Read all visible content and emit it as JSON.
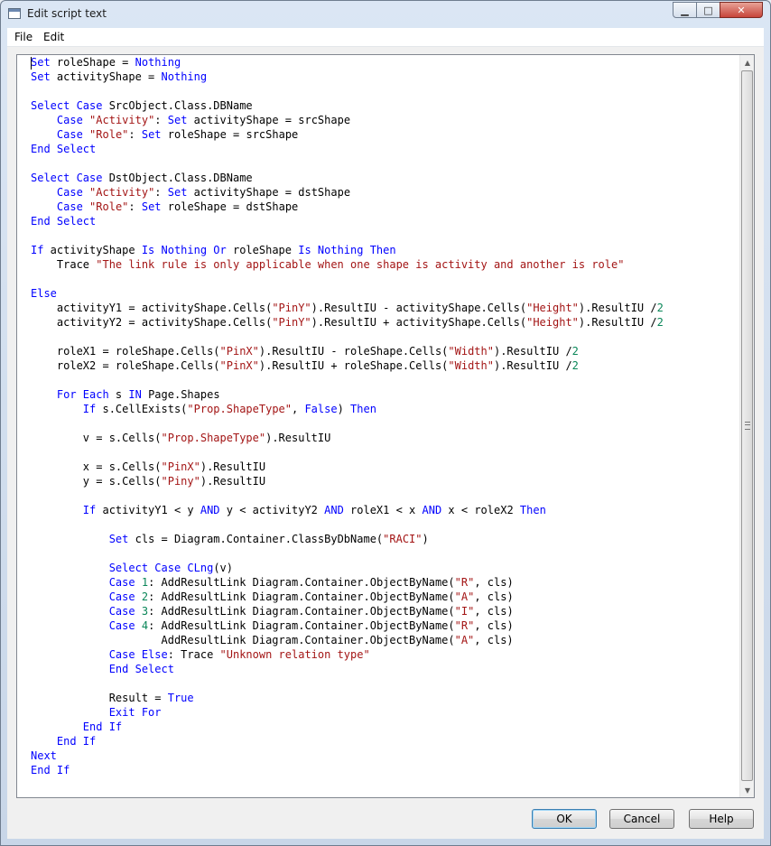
{
  "window": {
    "title": "Edit script text"
  },
  "title_controls": {
    "minimize_icon": "minimize-icon",
    "maximize_icon": "maximize-icon",
    "close_icon": "close-icon"
  },
  "menu": {
    "items": [
      "File",
      "Edit"
    ]
  },
  "editor": {
    "lines": [
      [
        [
          "kw",
          "Set"
        ],
        [
          "t",
          " roleShape = "
        ],
        [
          "kw",
          "Nothing"
        ]
      ],
      [
        [
          "kw",
          "Set"
        ],
        [
          "t",
          " activityShape = "
        ],
        [
          "kw",
          "Nothing"
        ]
      ],
      [],
      [
        [
          "kw",
          "Select Case"
        ],
        [
          "t",
          " SrcObject.Class.DBName"
        ]
      ],
      [
        [
          "t",
          "    "
        ],
        [
          "kw",
          "Case"
        ],
        [
          "t",
          " "
        ],
        [
          "str",
          "\"Activity\""
        ],
        [
          "t",
          ": "
        ],
        [
          "kw",
          "Set"
        ],
        [
          "t",
          " activityShape = srcShape"
        ]
      ],
      [
        [
          "t",
          "    "
        ],
        [
          "kw",
          "Case"
        ],
        [
          "t",
          " "
        ],
        [
          "str",
          "\"Role\""
        ],
        [
          "t",
          ": "
        ],
        [
          "kw",
          "Set"
        ],
        [
          "t",
          " roleShape = srcShape"
        ]
      ],
      [
        [
          "kw",
          "End Select"
        ]
      ],
      [],
      [
        [
          "kw",
          "Select Case"
        ],
        [
          "t",
          " DstObject.Class.DBName"
        ]
      ],
      [
        [
          "t",
          "    "
        ],
        [
          "kw",
          "Case"
        ],
        [
          "t",
          " "
        ],
        [
          "str",
          "\"Activity\""
        ],
        [
          "t",
          ": "
        ],
        [
          "kw",
          "Set"
        ],
        [
          "t",
          " activityShape = dstShape"
        ]
      ],
      [
        [
          "t",
          "    "
        ],
        [
          "kw",
          "Case"
        ],
        [
          "t",
          " "
        ],
        [
          "str",
          "\"Role\""
        ],
        [
          "t",
          ": "
        ],
        [
          "kw",
          "Set"
        ],
        [
          "t",
          " roleShape = dstShape"
        ]
      ],
      [
        [
          "kw",
          "End Select"
        ]
      ],
      [],
      [
        [
          "kw",
          "If"
        ],
        [
          "t",
          " activityShape "
        ],
        [
          "kw",
          "Is Nothing Or"
        ],
        [
          "t",
          " roleShape "
        ],
        [
          "kw",
          "Is Nothing Then"
        ]
      ],
      [
        [
          "t",
          "    Trace "
        ],
        [
          "str",
          "\"The link rule is only applicable when one shape is activity and another is role\""
        ]
      ],
      [],
      [
        [
          "kw",
          "Else"
        ]
      ],
      [
        [
          "t",
          "    activityY1 = activityShape.Cells("
        ],
        [
          "str",
          "\"PinY\""
        ],
        [
          "t",
          ").ResultIU - activityShape.Cells("
        ],
        [
          "str",
          "\"Height\""
        ],
        [
          "t",
          ").ResultIU /"
        ],
        [
          "num",
          "2"
        ]
      ],
      [
        [
          "t",
          "    activityY2 = activityShape.Cells("
        ],
        [
          "str",
          "\"PinY\""
        ],
        [
          "t",
          ").ResultIU + activityShape.Cells("
        ],
        [
          "str",
          "\"Height\""
        ],
        [
          "t",
          ").ResultIU /"
        ],
        [
          "num",
          "2"
        ]
      ],
      [],
      [
        [
          "t",
          "    roleX1 = roleShape.Cells("
        ],
        [
          "str",
          "\"PinX\""
        ],
        [
          "t",
          ").ResultIU - roleShape.Cells("
        ],
        [
          "str",
          "\"Width\""
        ],
        [
          "t",
          ").ResultIU /"
        ],
        [
          "num",
          "2"
        ]
      ],
      [
        [
          "t",
          "    roleX2 = roleShape.Cells("
        ],
        [
          "str",
          "\"PinX\""
        ],
        [
          "t",
          ").ResultIU + roleShape.Cells("
        ],
        [
          "str",
          "\"Width\""
        ],
        [
          "t",
          ").ResultIU /"
        ],
        [
          "num",
          "2"
        ]
      ],
      [],
      [
        [
          "t",
          "    "
        ],
        [
          "kw",
          "For Each"
        ],
        [
          "t",
          " s "
        ],
        [
          "kw",
          "IN"
        ],
        [
          "t",
          " Page.Shapes"
        ]
      ],
      [
        [
          "t",
          "        "
        ],
        [
          "kw",
          "If"
        ],
        [
          "t",
          " s.CellExists("
        ],
        [
          "str",
          "\"Prop.ShapeType\""
        ],
        [
          "t",
          ", "
        ],
        [
          "kw",
          "False"
        ],
        [
          "t",
          ") "
        ],
        [
          "kw",
          "Then"
        ]
      ],
      [],
      [
        [
          "t",
          "        v = s.Cells("
        ],
        [
          "str",
          "\"Prop.ShapeType\""
        ],
        [
          "t",
          ").ResultIU"
        ]
      ],
      [],
      [
        [
          "t",
          "        x = s.Cells("
        ],
        [
          "str",
          "\"PinX\""
        ],
        [
          "t",
          ").ResultIU"
        ]
      ],
      [
        [
          "t",
          "        y = s.Cells("
        ],
        [
          "str",
          "\"Piny\""
        ],
        [
          "t",
          ").ResultIU"
        ]
      ],
      [],
      [
        [
          "t",
          "        "
        ],
        [
          "kw",
          "If"
        ],
        [
          "t",
          " activityY1 < y "
        ],
        [
          "kw",
          "AND"
        ],
        [
          "t",
          " y < activityY2 "
        ],
        [
          "kw",
          "AND"
        ],
        [
          "t",
          " roleX1 < x "
        ],
        [
          "kw",
          "AND"
        ],
        [
          "t",
          " x < roleX2 "
        ],
        [
          "kw",
          "Then"
        ]
      ],
      [],
      [
        [
          "t",
          "            "
        ],
        [
          "kw",
          "Set"
        ],
        [
          "t",
          " cls = Diagram.Container.ClassByDbName("
        ],
        [
          "str",
          "\"RACI\""
        ],
        [
          "t",
          ")"
        ]
      ],
      [],
      [
        [
          "t",
          "            "
        ],
        [
          "kw",
          "Select Case"
        ],
        [
          "t",
          " "
        ],
        [
          "kw",
          "CLng"
        ],
        [
          "t",
          "(v)"
        ]
      ],
      [
        [
          "t",
          "            "
        ],
        [
          "kw",
          "Case"
        ],
        [
          "t",
          " "
        ],
        [
          "num",
          "1"
        ],
        [
          "t",
          ": AddResultLink Diagram.Container.ObjectByName("
        ],
        [
          "str",
          "\"R\""
        ],
        [
          "t",
          ", cls)"
        ]
      ],
      [
        [
          "t",
          "            "
        ],
        [
          "kw",
          "Case"
        ],
        [
          "t",
          " "
        ],
        [
          "num",
          "2"
        ],
        [
          "t",
          ": AddResultLink Diagram.Container.ObjectByName("
        ],
        [
          "str",
          "\"A\""
        ],
        [
          "t",
          ", cls)"
        ]
      ],
      [
        [
          "t",
          "            "
        ],
        [
          "kw",
          "Case"
        ],
        [
          "t",
          " "
        ],
        [
          "num",
          "3"
        ],
        [
          "t",
          ": AddResultLink Diagram.Container.ObjectByName("
        ],
        [
          "str",
          "\"I\""
        ],
        [
          "t",
          ", cls)"
        ]
      ],
      [
        [
          "t",
          "            "
        ],
        [
          "kw",
          "Case"
        ],
        [
          "t",
          " "
        ],
        [
          "num",
          "4"
        ],
        [
          "t",
          ": AddResultLink Diagram.Container.ObjectByName("
        ],
        [
          "str",
          "\"R\""
        ],
        [
          "t",
          ", cls)"
        ]
      ],
      [
        [
          "t",
          "                    AddResultLink Diagram.Container.ObjectByName("
        ],
        [
          "str",
          "\"A\""
        ],
        [
          "t",
          ", cls)"
        ]
      ],
      [
        [
          "t",
          "            "
        ],
        [
          "kw",
          "Case Else"
        ],
        [
          "t",
          ": Trace "
        ],
        [
          "str",
          "\"Unknown relation type\""
        ]
      ],
      [
        [
          "t",
          "            "
        ],
        [
          "kw",
          "End Select"
        ]
      ],
      [],
      [
        [
          "t",
          "            Result = "
        ],
        [
          "kw",
          "True"
        ]
      ],
      [
        [
          "t",
          "            "
        ],
        [
          "kw",
          "Exit For"
        ]
      ],
      [
        [
          "t",
          "        "
        ],
        [
          "kw",
          "End If"
        ]
      ],
      [
        [
          "t",
          "    "
        ],
        [
          "kw",
          "End If"
        ]
      ],
      [
        [
          "kw",
          "Next"
        ]
      ],
      [
        [
          "kw",
          "End If"
        ]
      ]
    ]
  },
  "scrollbar": {
    "up_icon": "scroll-up-arrow-icon",
    "down_icon": "scroll-down-arrow-icon"
  },
  "buttons": {
    "ok": "OK",
    "cancel": "Cancel",
    "help": "Help"
  },
  "colors": {
    "keyword": "#0000ff",
    "string": "#a31515",
    "number": "#098658",
    "text": "#000000"
  }
}
